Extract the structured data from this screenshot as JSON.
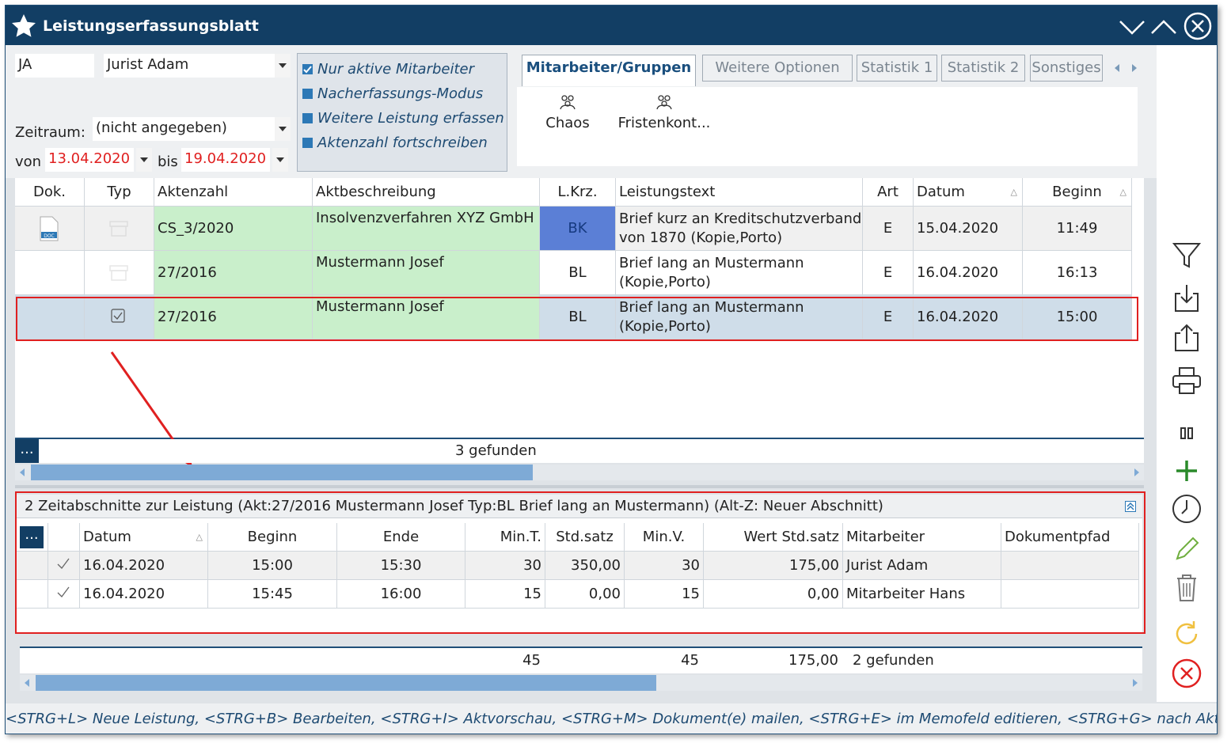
{
  "window": {
    "title": "Leistungserfassungsblatt"
  },
  "filter": {
    "kuerzel": "JA",
    "mitarbeiter": "Jurist Adam",
    "zeitraum_label": "Zeitraum:",
    "zeitraum_value": "(nicht angegeben)",
    "von_label": "von",
    "von_value": "13.04.2020",
    "bis_label": "bis",
    "bis_value": "19.04.2020"
  },
  "options": [
    "Nur aktive Mitarbeiter",
    "Nacherfassungs-Modus",
    "Weitere Leistung erfassen",
    "Aktenzahl fortschreiben"
  ],
  "tabs": [
    "Mitarbeiter/Gruppen",
    "Weitere Optionen",
    "Statistik 1",
    "Statistik 2",
    "Sonstiges"
  ],
  "groups": [
    "Chaos",
    "Fristenkont..."
  ],
  "main_table": {
    "headers": [
      "Dok.",
      "Typ",
      "Aktenzahl",
      "Aktbeschreibung",
      "L.Krz.",
      "Leistungstext",
      "Art",
      "Datum",
      "Beginn"
    ],
    "rows": [
      {
        "aktenzahl": "CS_3/2020",
        "beschreibung": "Insolvenzverfahren XYZ GmbH",
        "lkrz": "BK",
        "text1": "Brief kurz an Kreditschutzverband",
        "text2": "von 1870 (Kopie,Porto)",
        "art": "E",
        "datum": "15.04.2020",
        "beginn": "11:49"
      },
      {
        "aktenzahl": "27/2016",
        "beschreibung": "Mustermann Josef",
        "lkrz": "BL",
        "text1": "Brief lang an Mustermann",
        "text2": "(Kopie,Porto)",
        "art": "E",
        "datum": "16.04.2020",
        "beginn": "16:13"
      },
      {
        "aktenzahl": "27/2016",
        "beschreibung": "Mustermann Josef",
        "lkrz": "BL",
        "text1": "Brief lang an Mustermann",
        "text2": "(Kopie,Porto)",
        "art": "E",
        "datum": "16.04.2020",
        "beginn": "15:00"
      }
    ],
    "found": "3 gefunden",
    "ellipsis": "..."
  },
  "sub_table": {
    "title": "2 Zeitabschnitte zur Leistung (Akt:27/2016 Mustermann Josef  Typ:BL Brief lang an Mustermann) (Alt-Z: Neuer Abschnitt)",
    "headers": [
      "Datum",
      "Beginn",
      "Ende",
      "Min.T.",
      "Std.satz",
      "Min.V.",
      "Wert Std.satz",
      "Mitarbeiter",
      "Dokumentpfad"
    ],
    "rows": [
      {
        "datum": "16.04.2020",
        "beginn": "15:00",
        "ende": "15:30",
        "mint": "30",
        "stdsatz": "350,00",
        "minv": "30",
        "wert": "175,00",
        "mitarbeiter": "Jurist Adam"
      },
      {
        "datum": "16.04.2020",
        "beginn": "15:45",
        "ende": "16:00",
        "mint": "15",
        "stdsatz": "0,00",
        "minv": "15",
        "wert": "0,00",
        "mitarbeiter": "Mitarbeiter Hans"
      }
    ],
    "totals": {
      "mint": "45",
      "minv": "45",
      "wert": "175,00",
      "found": "2 gefunden"
    },
    "ellipsis": "..."
  },
  "footer": "<STRG+L> Neue Leistung, <STRG+B> Bearbeiten, <STRG+I> Aktvorschau, <STRG+M> Dokument(e) mailen, <STRG+E> im Memofeld editieren, <STRG+G> nach Akt gruppieren",
  "sidebar_icons": [
    "filter-icon",
    "import-icon",
    "export-icon",
    "print-icon",
    "columns-icon",
    "add-icon",
    "clock-icon",
    "edit-icon",
    "delete-icon",
    "refresh-icon",
    "cancel-icon"
  ],
  "colors": {
    "title_bar": "#123e64",
    "accent": "#2c78b6",
    "green_cell": "#c9efcb",
    "highlight": "#e02020"
  }
}
